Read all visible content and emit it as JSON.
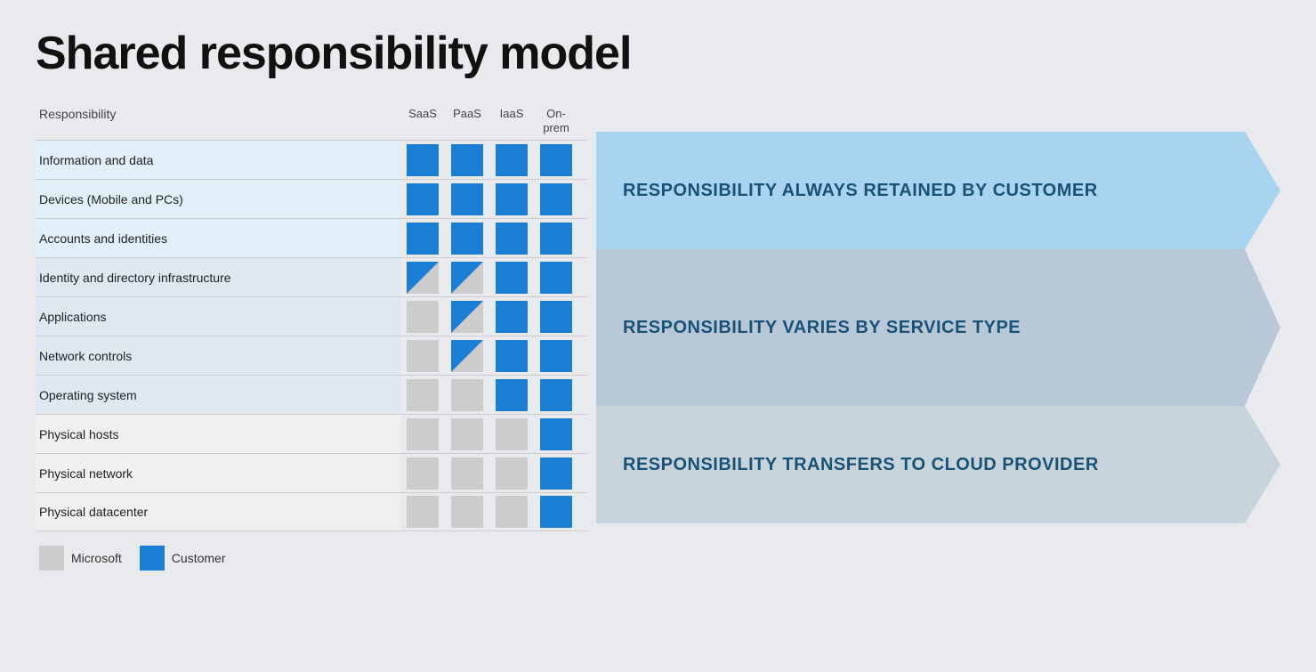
{
  "title": "Shared responsibility model",
  "table": {
    "responsibility_label": "Responsibility",
    "columns": [
      "SaaS",
      "PaaS",
      "IaaS",
      "On-\nprem"
    ],
    "rows": [
      {
        "label": "Information and data",
        "group": 1,
        "cells": [
          "blue",
          "blue",
          "blue",
          "blue"
        ]
      },
      {
        "label": "Devices (Mobile and PCs)",
        "group": 1,
        "cells": [
          "blue",
          "blue",
          "blue",
          "blue"
        ]
      },
      {
        "label": "Accounts and identities",
        "group": 1,
        "cells": [
          "blue",
          "blue",
          "blue",
          "blue"
        ]
      },
      {
        "label": "Identity and directory infrastructure",
        "group": 2,
        "cells": [
          "half",
          "half",
          "blue",
          "blue"
        ]
      },
      {
        "label": "Applications",
        "group": 2,
        "cells": [
          "gray",
          "half",
          "blue",
          "blue"
        ]
      },
      {
        "label": "Network controls",
        "group": 2,
        "cells": [
          "gray",
          "half",
          "blue",
          "blue"
        ]
      },
      {
        "label": "Operating system",
        "group": 2,
        "cells": [
          "gray",
          "gray",
          "blue",
          "blue"
        ]
      },
      {
        "label": "Physical hosts",
        "group": 3,
        "cells": [
          "gray",
          "gray",
          "gray",
          "blue"
        ]
      },
      {
        "label": "Physical network",
        "group": 3,
        "cells": [
          "gray",
          "gray",
          "gray",
          "blue"
        ]
      },
      {
        "label": "Physical datacenter",
        "group": 3,
        "cells": [
          "gray",
          "gray",
          "gray",
          "blue"
        ]
      }
    ]
  },
  "bands": [
    {
      "label": "RESPONSIBILITY ALWAYS RETAINED BY CUSTOMER",
      "rows": 3
    },
    {
      "label": "RESPONSIBILITY VARIES BY SERVICE TYPE",
      "rows": 4
    },
    {
      "label": "RESPONSIBILITY TRANSFERS TO CLOUD PROVIDER",
      "rows": 3
    }
  ],
  "legend": {
    "microsoft_label": "Microsoft",
    "customer_label": "Customer"
  }
}
